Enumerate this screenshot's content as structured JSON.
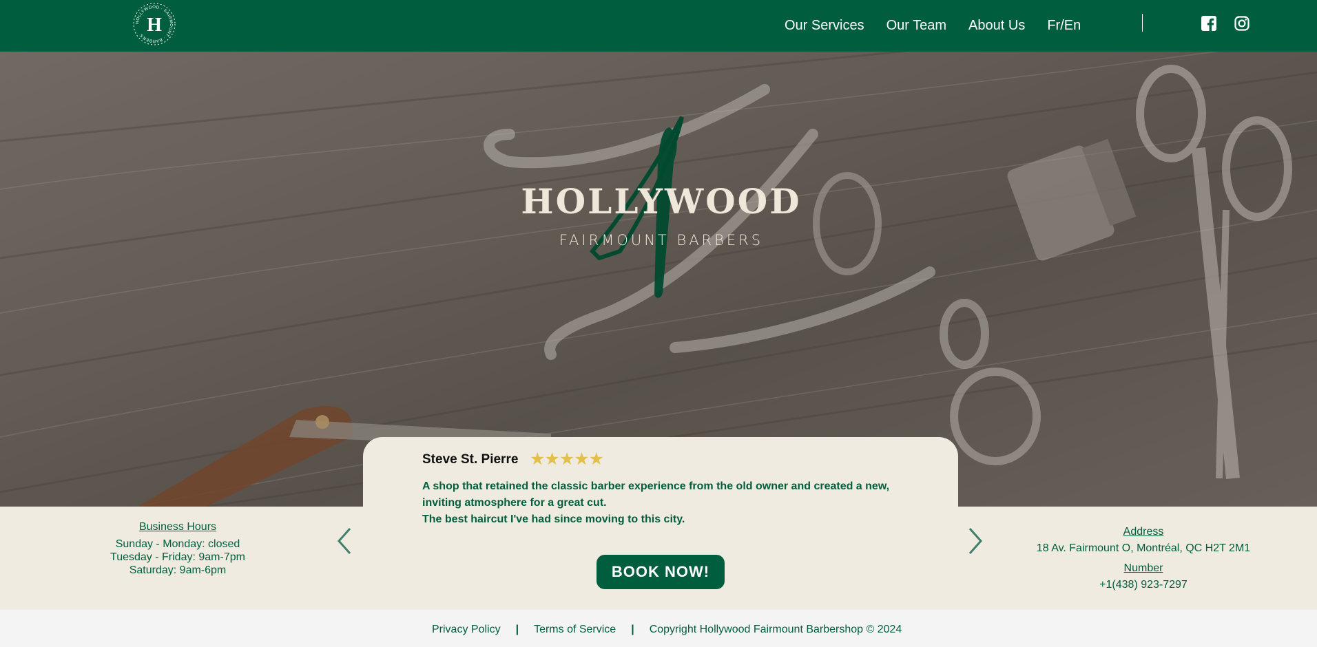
{
  "nav": {
    "logo": {
      "initial": "H",
      "ring_text": "HOLLYWOOD · FAIRMOUNT · BARBERS"
    },
    "links": [
      "Our Services",
      "Our Team",
      "About Us",
      "Fr/En"
    ],
    "social_icons": [
      "facebook-icon",
      "instagram-icon"
    ]
  },
  "hero": {
    "title": "HOLLYWOOD",
    "subtitle": "FAIRMOUNT BARBERS"
  },
  "review": {
    "name": "Steve St. Pierre",
    "rating": 5,
    "stars": "★★★★★",
    "text_line1": "A shop that retained the classic barber experience from the old owner and created a new,",
    "text_line2": "inviting atmosphere for a great cut.",
    "text_line3": "The best haircut I've had since moving to this city.",
    "book_label": "BOOK NOW!"
  },
  "hours": {
    "title": "Business Hours",
    "lines": [
      "Sunday - Monday: closed",
      "Tuesday - Friday: 9am-7pm",
      "Saturday: 9am-6pm"
    ]
  },
  "contact": {
    "address_title": "Address",
    "address": "18 Av. Fairmount O, Montréal, QC H2T 2M1",
    "number_title": "Number",
    "number": "+1(438) 923-7297"
  },
  "footer": {
    "privacy": "Privacy Policy",
    "terms": "Terms of Service",
    "copyright": "Copyright Hollywood Fairmount Barbershop © 2024",
    "separator": "|"
  },
  "colors": {
    "brand_green": "#005e3e",
    "cream": "#efebe0",
    "star_gold": "#e2c04a"
  }
}
